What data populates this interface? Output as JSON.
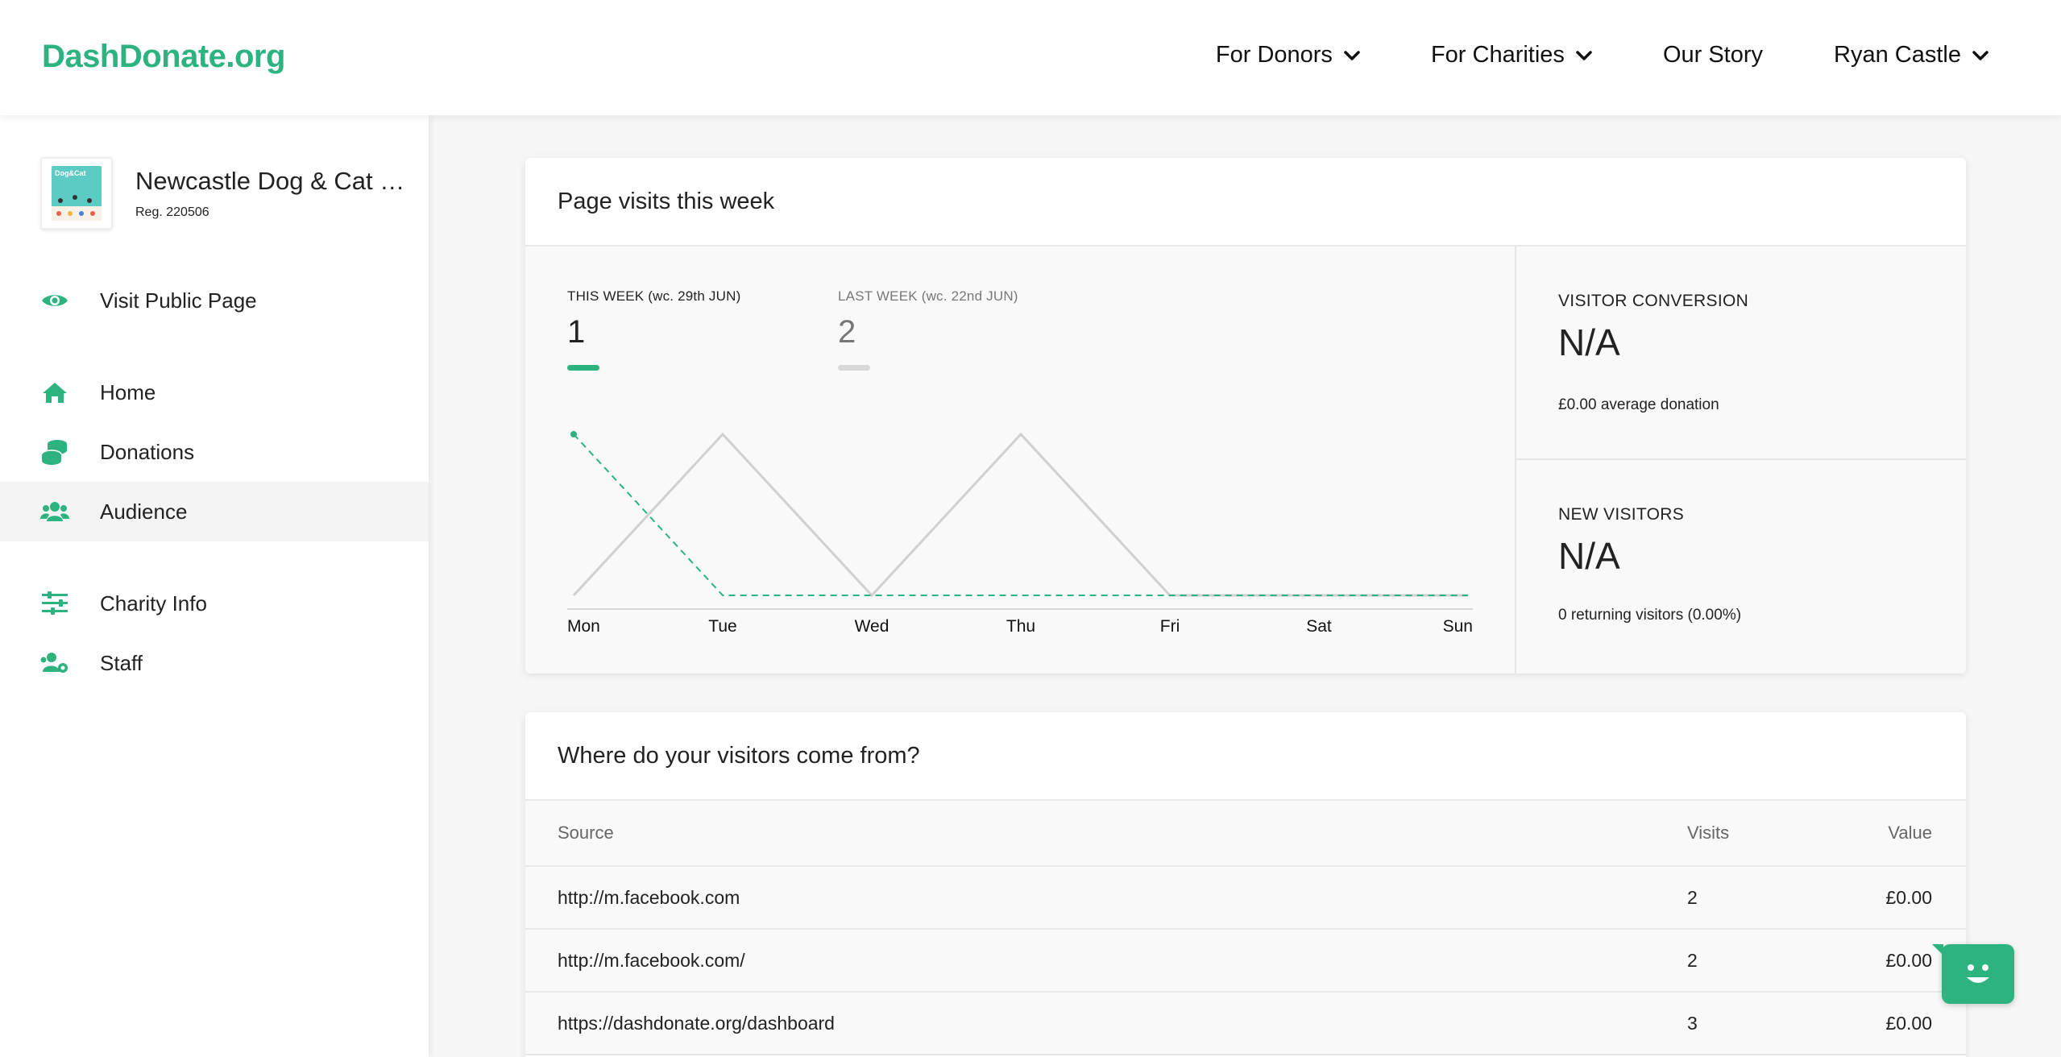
{
  "brand": {
    "logo_text": "DashDonate.org",
    "accent": "#2db37f"
  },
  "nav": {
    "items": [
      {
        "label": "For Donors",
        "dropdown": true
      },
      {
        "label": "For Charities",
        "dropdown": true
      },
      {
        "label": "Our Story",
        "dropdown": false
      },
      {
        "label": "Ryan Castle",
        "dropdown": true
      }
    ]
  },
  "charity": {
    "name": "Newcastle Dog & Cat …",
    "reg": "Reg. 220506",
    "logo_text": "Dog&Cat"
  },
  "sidebar": {
    "items": [
      {
        "label": "Visit Public Page",
        "icon": "eye-icon"
      },
      {
        "label": "Home",
        "icon": "home-icon"
      },
      {
        "label": "Donations",
        "icon": "coins-icon"
      },
      {
        "label": "Audience",
        "icon": "users-icon",
        "active": true
      },
      {
        "label": "Charity Info",
        "icon": "sliders-icon"
      },
      {
        "label": "Staff",
        "icon": "users-cog-icon"
      }
    ]
  },
  "visits": {
    "title": "Page visits this week",
    "this_week": {
      "label": "THIS WEEK (wc. 29th JUN)",
      "value": "1"
    },
    "last_week": {
      "label": "LAST WEEK (wc. 22nd JUN)",
      "value": "2"
    },
    "conversion": {
      "label": "VISITOR CONVERSION",
      "value": "N/A",
      "sub": "£0.00 average donation"
    },
    "new_visitors": {
      "label": "NEW VISITORS",
      "value": "N/A",
      "sub": "0 returning visitors (0.00%)"
    }
  },
  "chart_data": {
    "type": "line",
    "categories": [
      "Mon",
      "Tue",
      "Wed",
      "Thu",
      "Fri",
      "Sat",
      "Sun"
    ],
    "series": [
      {
        "name": "THIS WEEK (wc. 29th JUN)",
        "values": [
          1,
          0,
          0,
          0,
          0,
          0,
          0
        ],
        "color": "#2db37f",
        "style": "dashed"
      },
      {
        "name": "LAST WEEK (wc. 22nd JUN)",
        "values": [
          0,
          1,
          0,
          1,
          0,
          0,
          0
        ],
        "color": "#d0d0d0",
        "style": "solid"
      }
    ],
    "ylim": [
      0,
      1
    ],
    "grid": false
  },
  "sources": {
    "title": "Where do your visitors come from?",
    "columns": [
      "Source",
      "Visits",
      "Value"
    ],
    "rows": [
      {
        "source": "http://m.facebook.com",
        "visits": "2",
        "value": "£0.00"
      },
      {
        "source": "http://m.facebook.com/",
        "visits": "2",
        "value": "£0.00"
      },
      {
        "source": "https://dashdonate.org/dashboard",
        "visits": "3",
        "value": "£0.00"
      }
    ]
  }
}
